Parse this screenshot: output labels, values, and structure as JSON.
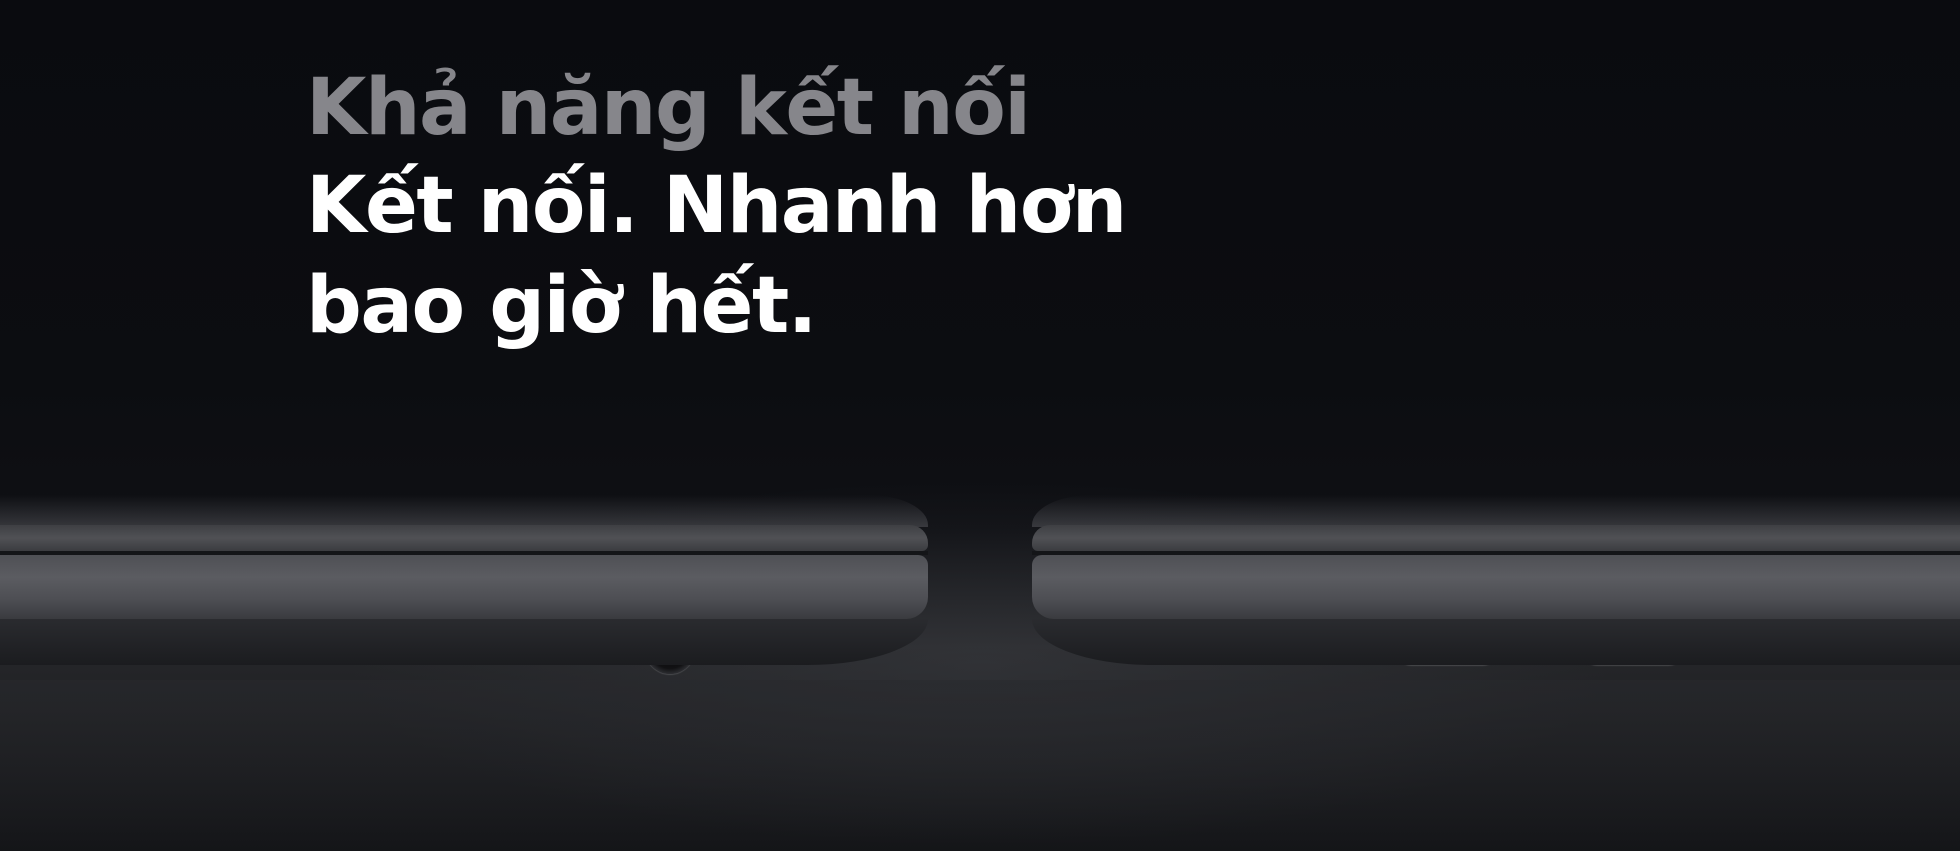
{
  "headline": {
    "eyebrow": "Khả năng kết nối",
    "title_line_1": "Kết nối. Nhanh hơn",
    "title_line_2": "bao giờ hết."
  },
  "colors": {
    "background": "#0b0c10",
    "eyebrow_text": "#86868b",
    "title_text": "#ffffff",
    "aluminum": "#55565b"
  },
  "icons": {
    "left_laptop_port": "audio-jack-icon",
    "right_laptop_ports": [
      "usb-c-port-icon",
      "usb-c-port-icon"
    ]
  }
}
